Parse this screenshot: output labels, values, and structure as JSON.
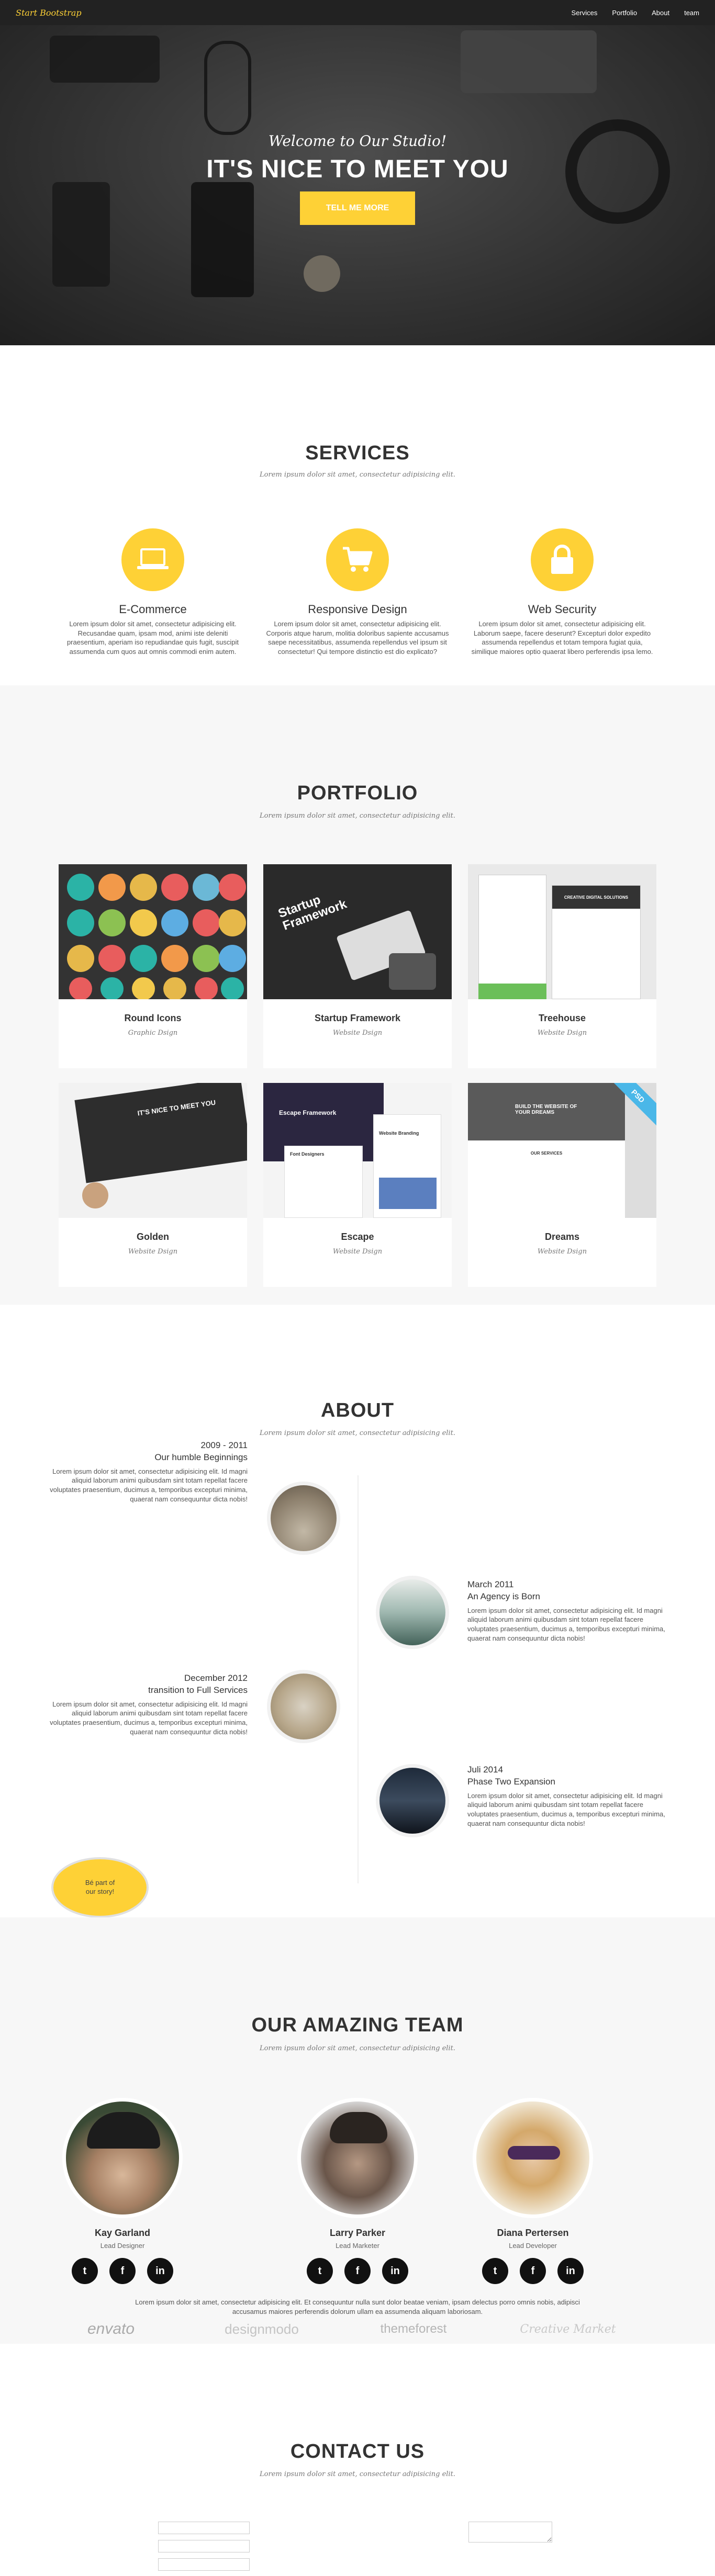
{
  "nav": {
    "brand": "Start Bootstrap",
    "links": [
      "Services",
      "Portfolio",
      "About",
      "team"
    ]
  },
  "hero": {
    "welcome": "Welcome to Our Studio!",
    "title": "IT'S NICE TO MEET YOU",
    "cta": "TELL ME MORE"
  },
  "services": {
    "title": "SERVICES",
    "subtitle": "Lorem ipsum dolor sit amet, consectetur adipisicing elit.",
    "items": [
      {
        "icon": "laptop-icon",
        "title": "E-Commerce",
        "text": "Lorem ipsum dolor sit amet, consectetur adipisicing elit. Recusandae quam, ipsam mod, animi iste deleniti praesentium, aperiam iso repudiandae quis fugit, suscipit assumenda cum quos aut omnis commodi enim autem."
      },
      {
        "icon": "cart-icon",
        "title": "Responsive Design",
        "text": "Lorem ipsum dolor sit amet, consectetur adipisicing elit. Corporis atque harum, molitia doloribus sapiente accusamus saepe necessitatibus, assumenda repellendus vel ipsum sit consectetur! Qui tempore distinctio est dio explicato?"
      },
      {
        "icon": "lock-icon",
        "title": "Web Security",
        "text": "Lorem ipsum dolor sit amet, consectetur adipisicing elit. Laborum saepe, facere deserunt? Excepturi dolor expedito assumenda repellendus et totam tempora fugiat quia, similique maiores optio quaerat libero perferendis ipsa lemo."
      }
    ]
  },
  "portfolio": {
    "title": "PORTFOLIO",
    "subtitle": "Lorem ipsum dolor sit amet, consectetur adipisicing elit.",
    "items": [
      {
        "title": "Round Icons",
        "category": "Graphic Dsign"
      },
      {
        "title": "Startup Framework",
        "category": "Website Dsign"
      },
      {
        "title": "Treehouse",
        "category": "Website Dsign"
      },
      {
        "title": "Golden",
        "category": "Website Dsign"
      },
      {
        "title": "Escape",
        "category": "Website Dsign"
      },
      {
        "title": "Dreams",
        "category": "Website Dsign"
      }
    ],
    "thumb_texts": {
      "startup": "Startup Framework",
      "golden": "IT'S NICE TO MEET YOU",
      "escape_1": "Escape Framework",
      "escape_2": "Font Designers",
      "escape_3": "Website Branding",
      "dreams_1": "BUILD THE WEBSITE OF YOUR DREAMS",
      "dreams_2": "OUR SERVICES",
      "dreams_badge": "PSD",
      "treehouse": "CREATIVE DIGITAL SOLUTIONS"
    }
  },
  "about": {
    "title": "ABOUT",
    "subtitle": "Lorem ipsum dolor sit amet, consectetur adipisicing elit.",
    "events": [
      {
        "date": "2009 - 2011",
        "heading": "Our humble Beginnings",
        "text": "Lorem ipsum dolor sit amet, consectetur adipisicing elit. Id magni aliquid laborum animi quibusdam sint totam repellat facere voluptates praesentium, ducimus a, temporibus excepturi minima, quaerat nam consequuntur dicta nobis!"
      },
      {
        "date": "March 2011",
        "heading": "An Agency is Born",
        "text": "Lorem ipsum dolor sit amet, consectetur adipisicing elit. Id magni aliquid laborum animi quibusdam sint totam repellat facere voluptates praesentium, ducimus a, temporibus excepturi minima, quaerat nam consequuntur dicta nobis!"
      },
      {
        "date": "December 2012",
        "heading": "transition to Full Services",
        "text": "Lorem ipsum dolor sit amet, consectetur adipisicing elit. Id magni aliquid laborum animi quibusdam sint totam repellat facere voluptates praesentium, ducimus a, temporibus excepturi minima, quaerat nam consequuntur dicta nobis!"
      },
      {
        "date": "Juli 2014",
        "heading": "Phase Two Expansion",
        "text": "Lorem ipsum dolor sit amet, consectetur adipisicing elit. Id magni aliquid laborum animi quibusdam sint totam repellat facere voluptates praesentium, ducimus a, temporibus excepturi minima, quaerat nam consequuntur dicta nobis!"
      }
    ],
    "bubble": "Bé part of our story!"
  },
  "team": {
    "title": "OUR AMAZING TEAM",
    "subtitle": "Lorem ipsum dolor sit amet, consectetur adipisicing elit.",
    "members": [
      {
        "name": "Kay Garland",
        "role": "Lead Designer"
      },
      {
        "name": "Larry Parker",
        "role": "Lead Marketer"
      },
      {
        "name": "Diana Pertersen",
        "role": "Lead Developer"
      }
    ],
    "social": {
      "twitter": "t",
      "facebook": "f",
      "linkedin": "in"
    },
    "note": "Lorem ipsum dolor sit amet, consectetur adipisicing elit. Et consequuntur nulla sunt dolor beatae veniam, ipsam delectus porro omnis nobis, adipisci accusamus maiores perferendis dolorum ullam ea assumenda aliquam laboriosam.",
    "logos": [
      "envato",
      "designmodo",
      "themeforest",
      "Creative Market"
    ]
  },
  "contact": {
    "title": "CONTACT US",
    "subtitle": "Lorem ipsum dolor sit amet, consectetur adipisicing elit."
  },
  "colors": {
    "accent": "#fed136",
    "dark": "#222222",
    "light_bg": "#f7f7f7"
  }
}
